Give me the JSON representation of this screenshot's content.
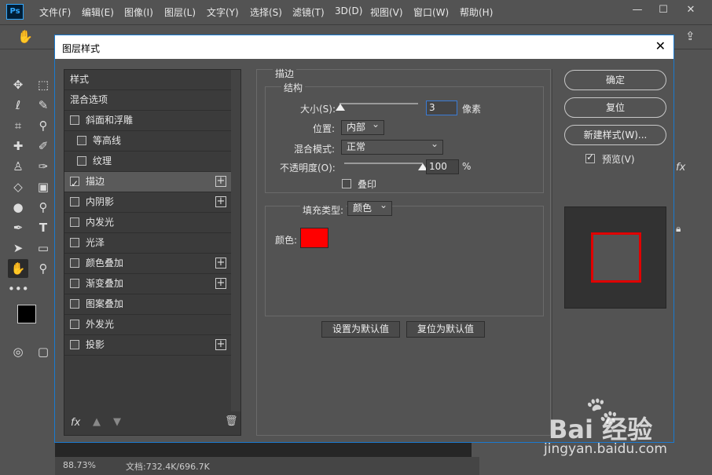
{
  "app": {
    "logo": "Ps",
    "menu": [
      "文件(F)",
      "编辑(E)",
      "图像(I)",
      "图层(L)",
      "文字(Y)",
      "选择(S)",
      "滤镜(T)",
      "3D(D)",
      "视图(V)",
      "窗口(W)",
      "帮助(H)"
    ]
  },
  "status": {
    "zoom": "88.73%",
    "doc": "文档:732.4K/696.7K"
  },
  "dialog": {
    "title": "图层样式",
    "left": {
      "header": "样式",
      "blend_options": "混合选项",
      "items": [
        {
          "label": "斜面和浮雕",
          "checked": false,
          "plus": false
        },
        {
          "label": "等高线",
          "checked": false,
          "plus": false,
          "indent": true
        },
        {
          "label": "纹理",
          "checked": false,
          "plus": false,
          "indent": true
        },
        {
          "label": "描边",
          "checked": true,
          "plus": true,
          "active": true
        },
        {
          "label": "内阴影",
          "checked": false,
          "plus": true
        },
        {
          "label": "内发光",
          "checked": false,
          "plus": false
        },
        {
          "label": "光泽",
          "checked": false,
          "plus": false
        },
        {
          "label": "颜色叠加",
          "checked": false,
          "plus": true
        },
        {
          "label": "渐变叠加",
          "checked": false,
          "plus": true
        },
        {
          "label": "图案叠加",
          "checked": false,
          "plus": false
        },
        {
          "label": "外发光",
          "checked": false,
          "plus": false
        },
        {
          "label": "投影",
          "checked": false,
          "plus": true
        }
      ],
      "footer_fx": "fx"
    },
    "stroke": {
      "title": "描边",
      "structure_title": "结构",
      "size_label": "大小(S):",
      "size_value": "3",
      "size_unit": "像素",
      "size_slider": 0.01,
      "position_label": "位置:",
      "position_value": "内部",
      "blend_label": "混合模式:",
      "blend_value": "正常",
      "opacity_label": "不透明度(O):",
      "opacity_value": "100",
      "opacity_unit": "%",
      "opacity_slider": 1.0,
      "overprint_label": "叠印",
      "fill_type_label": "填充类型:",
      "fill_type_value": "颜色",
      "color_label": "颜色:",
      "color_value": "#ff0000",
      "set_default": "设置为默认值",
      "reset_default": "复位为默认值"
    },
    "right": {
      "ok": "确定",
      "reset": "复位",
      "new_style": "新建样式(W)...",
      "preview_label": "预览(V)",
      "preview_checked": true
    }
  },
  "watermark": {
    "brand": "Bai  经验",
    "url": "jingyan.baidu.com"
  }
}
